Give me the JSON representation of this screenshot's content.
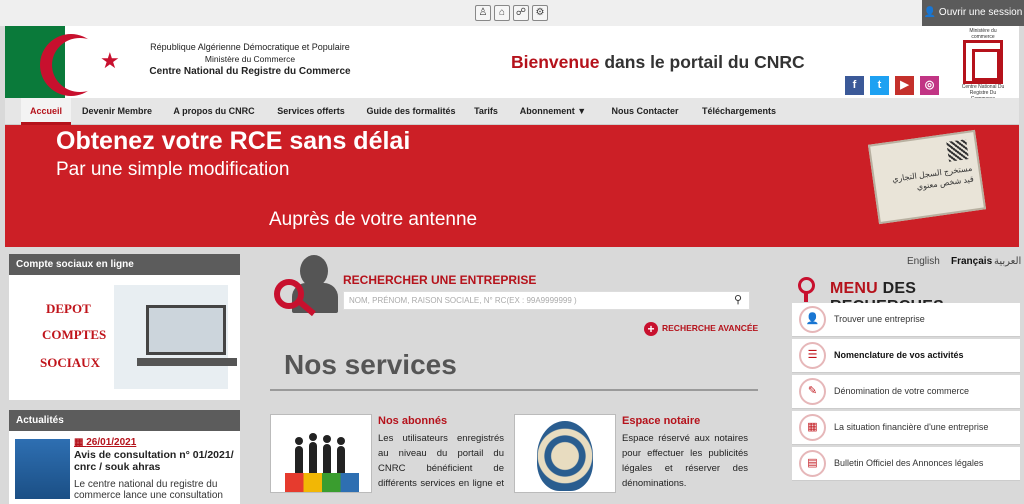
{
  "topbar": {
    "icons": [
      "person-icon",
      "home-icon",
      "sitemap-icon",
      "settings-icon"
    ],
    "login_label": "Ouvrir une session"
  },
  "header": {
    "org_line1": "République Algérienne Démocratique et Populaire",
    "org_line2": "Ministère du Commerce",
    "org_line3": "Centre National du Registre du Commerce",
    "welcome_red": "Bienvenue",
    "welcome_rest": " dans le portail du CNRC",
    "logo_caption_top": "Ministère du commerce",
    "logo_caption_bottom": "Centre National Du Registre Du Commerce",
    "socials": [
      {
        "name": "facebook-icon",
        "glyph": "f",
        "color": "#3b5998"
      },
      {
        "name": "twitter-icon",
        "glyph": "t",
        "color": "#1da1f2"
      },
      {
        "name": "youtube-icon",
        "glyph": "▶",
        "color": "#c4302b"
      },
      {
        "name": "instagram-icon",
        "glyph": "◎",
        "color": "#c13584"
      }
    ]
  },
  "nav": {
    "items": [
      {
        "label": "Accueil",
        "active": true
      },
      {
        "label": "Devenir Membre"
      },
      {
        "label": "A propos du CNRC"
      },
      {
        "label": "Services offerts"
      },
      {
        "label": "Guide des formalités"
      },
      {
        "label": "Tarifs"
      },
      {
        "label": "Abonnement  ▼"
      },
      {
        "label": "Nous Contacter"
      },
      {
        "label": "Téléchargements"
      }
    ]
  },
  "banner": {
    "line1": "Obtenez votre RCE sans délai",
    "line2": "Par une simple modification",
    "line3": "Auprès de votre antenne",
    "card_text": "مستخرج السجل التجاري قيد شخص معنوي"
  },
  "left": {
    "social_title": "Compte sociaux en ligne",
    "depot_words": [
      "DEPOT",
      "COMPTES",
      "SOCIAUX"
    ],
    "news_title": "Actualités",
    "news": {
      "date": "26/01/2021",
      "title": "Avis de consultation n° 01/2021/ cnrc / souk ahras",
      "text": "Le centre national du registre du commerce lance une consultation"
    }
  },
  "search": {
    "title": "RECHERCHER UNE ENTREPRISE",
    "placeholder": "NOM, PRÉNOM, RAISON SOCIALE, N° RC(EX : 99A9999999 )",
    "advanced": "RECHERCHE AVANCÉE"
  },
  "services": {
    "title": "Nos services",
    "items": [
      {
        "title": "Nos abonnés",
        "desc": "Les utilisateurs enregistrés au niveau du portail du CNRC bénéficient de différents services en ligne et de plus de services"
      },
      {
        "title": "Espace notaire",
        "desc": "Espace réservé aux notaires pour effectuer les publicités légales et réserver des dénominations."
      }
    ]
  },
  "lang": {
    "en": "English",
    "fr": "Français",
    "ar": "العربية"
  },
  "rmenu": {
    "title_red": "MENU",
    "title_dark": " DES RECHERCHES",
    "items": [
      {
        "label": "Trouver une entreprise",
        "icon": "person-icon",
        "glyph": "👤"
      },
      {
        "label": "Nomenclature de vos activités",
        "icon": "list-icon",
        "glyph": "☰"
      },
      {
        "label": "Dénomination de votre commerce",
        "icon": "tag-icon",
        "glyph": "✎"
      },
      {
        "label": "La situation financière d'une entreprise",
        "icon": "chart-icon",
        "glyph": "▦"
      },
      {
        "label": "Bulletin Officiel des Annonces légales",
        "icon": "book-icon",
        "glyph": "▤"
      }
    ]
  }
}
